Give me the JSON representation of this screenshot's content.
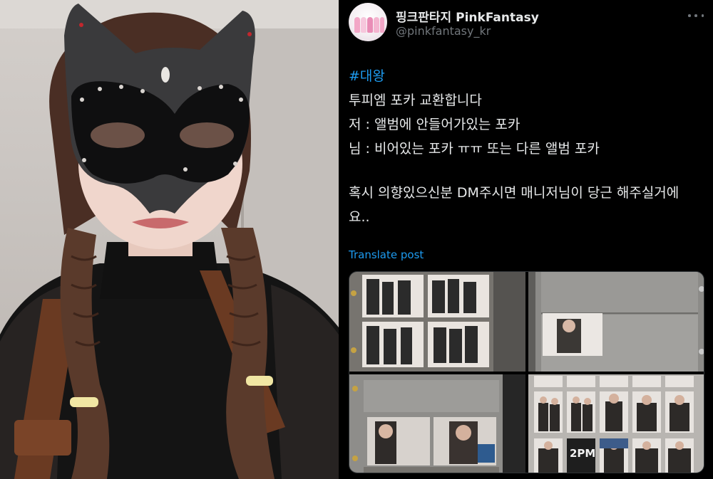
{
  "profile": {
    "display_name": "핑크판타지 PinkFantasy",
    "handle": "@pinkfantasy_kr"
  },
  "post": {
    "hashtag": "#대왕",
    "lines": [
      "투피엠 포카 교환합니다",
      "저 : 앨범에 안들어가있는 포카",
      "님 : 비어있는 포카 ㅠㅠ 또는 다른 앨범 포카",
      "혹시 의향있으신분 DM주시면 매니저님이 당근 해주실거에",
      "요.."
    ],
    "translate_label": "Translate post"
  },
  "media": {
    "photo_card_label": "2PM"
  },
  "colors": {
    "background": "#000000",
    "text": "#e7e9ea",
    "secondary_text": "#71767b",
    "link": "#1d9bf0"
  }
}
